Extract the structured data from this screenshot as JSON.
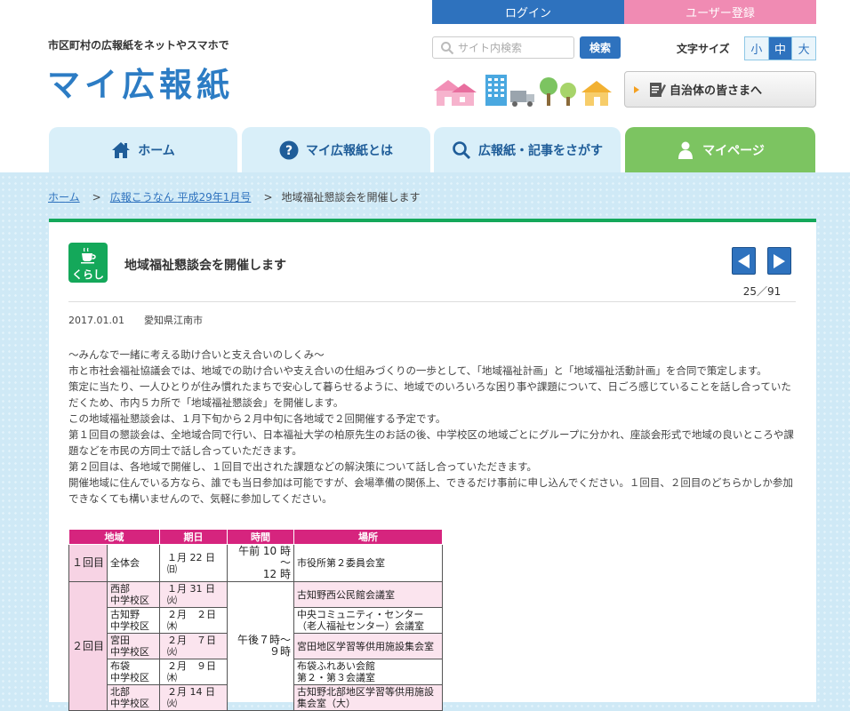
{
  "header": {
    "login": "ログイン",
    "register": "ユーザー登録",
    "tagline": "市区町村の広報紙をネットやスマホで",
    "logo": "マイ広報紙",
    "search_placeholder": "サイト内検索",
    "search_button": "検索",
    "font_size_label": "文字サイズ",
    "font_sizes": [
      "小",
      "中",
      "大"
    ],
    "municipal_link": "自治体の皆さまへ"
  },
  "nav": {
    "home": "ホーム",
    "about": "マイ広報紙とは",
    "search": "広報紙・記事をさがす",
    "mypage": "マイページ"
  },
  "breadcrumb": {
    "home": "ホーム",
    "issue": "広報こうなん 平成29年1月号",
    "current": "地域福祉懇談会を開催します"
  },
  "article": {
    "category": "くらし",
    "title": "地域福祉懇談会を開催します",
    "page_count": "25／91",
    "date": "2017.01.01",
    "city": "愛知県江南市",
    "paragraphs": [
      "～みんなで一緒に考える助け合いと支え合いのしくみ～",
      "市と市社会福祉協議会では、地域での助け合いや支え合いの仕組みづくりの一歩として、「地域福祉計画」と「地域福祉活動計画」を合同で策定します。",
      "策定に当たり、一人ひとりが住み慣れたまちで安心して暮らせるように、地域でのいろいろな困り事や課題について、日ごろ感じていることを話し合っていただくため、市内５カ所で「地域福祉懇談会」を開催します。",
      "この地域福祉懇談会は、１月下旬から２月中旬に各地域で２回開催する予定です。",
      "第１回目の懇談会は、全地域合同で行い、日本福祉大学の柏原先生のお話の後、中学校区の地域ごとにグループに分かれ、座談会形式で地域の良いところや課題などを市民の方同士で話し合っていただきます。",
      "第２回目は、各地域で開催し、１回目で出された課題などの解決策について話し合っていただきます。",
      "開催地域に住んでいる方なら、誰でも当日参加は可能ですが、会場準備の関係上、できるだけ事前に申し込んでください。１回目、２回目のどちらかしか参加できなくても構いませんので、気軽に参加してください。"
    ]
  },
  "schedule": {
    "headers": [
      "地域",
      "期日",
      "時間",
      "場所"
    ],
    "round1": {
      "label": "１回目",
      "area": "全体会",
      "date": "１月 22 日㈰",
      "time": "午前 10 時～\n12 時",
      "place": "市役所第２委員会室"
    },
    "round2_label": "２回目",
    "round2_time": "午後７時～\n９時",
    "round2": [
      {
        "area": "西部\n中学校区",
        "date": "１月 31 日㈫",
        "place": "古知野西公民館会議室"
      },
      {
        "area": "古知野\n中学校区",
        "date": "２月　２日㈭",
        "place": "中央コミュニティ・センター\n（老人福祉センター）会議室"
      },
      {
        "area": "宮田\n中学校区",
        "date": "２月　７日㈫",
        "place": "宮田地区学習等供用施設集会室"
      },
      {
        "area": "布袋\n中学校区",
        "date": "２月　９日㈭",
        "place": "布袋ふれあい会館\n第２・第３会議室"
      },
      {
        "area": "北部\n中学校区",
        "date": "２月 14 日㈫",
        "place": "古知野北部地区学習等供用施設\n集会室（大）"
      }
    ]
  },
  "colors": {
    "brand_blue": "#2e72be",
    "register_pink": "#f08bb3",
    "mypage_green": "#7cc461",
    "category_green": "#14a85a",
    "table_header_magenta": "#d6247e"
  }
}
